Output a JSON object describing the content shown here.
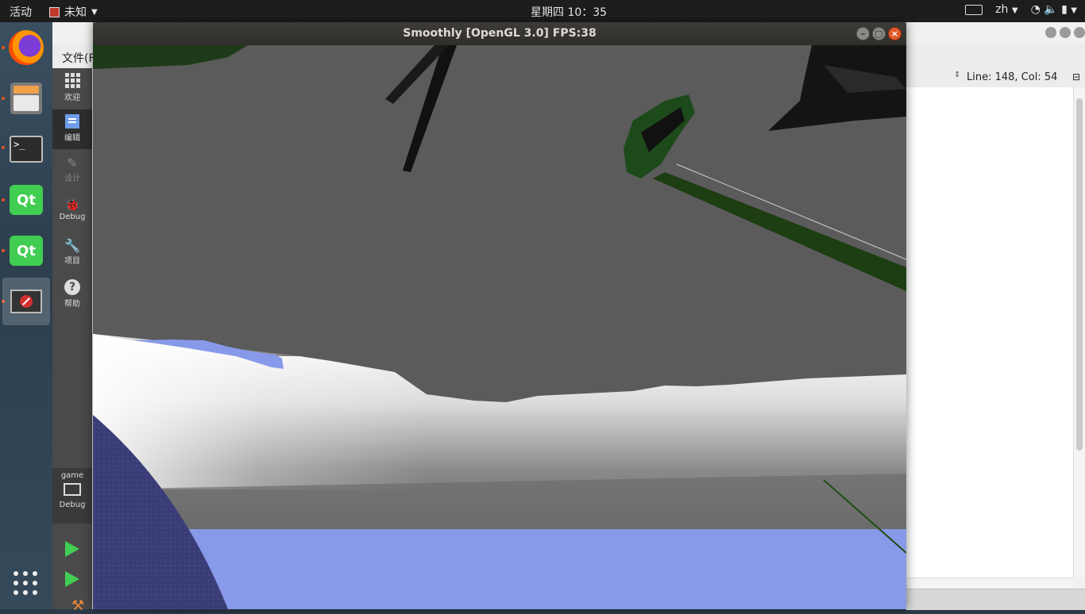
{
  "topbar": {
    "activities": "活动",
    "app_name": "未知",
    "clock": "星期四 10：35",
    "input_method": "zh"
  },
  "dock": {
    "items": [
      "firefox-icon",
      "files-icon",
      "terminal-icon",
      "qt-creator-icon",
      "qt-creator-icon",
      "unknown-app-icon"
    ],
    "terminal_prompt": ">_",
    "qt_label": "Qt"
  },
  "creator": {
    "menu_file": "文件(F)",
    "modes": [
      {
        "label": "欢迎"
      },
      {
        "label": "编辑"
      },
      {
        "label": "设计"
      },
      {
        "label": "Debug"
      },
      {
        "label": "项目"
      },
      {
        "label": "帮助"
      }
    ],
    "kit": {
      "project": "game",
      "build": "Debug"
    },
    "cursor_position": "Line: 148, Col: 54"
  },
  "game_window": {
    "title": "Smoothly [OpenGL 3.0] FPS:38"
  }
}
